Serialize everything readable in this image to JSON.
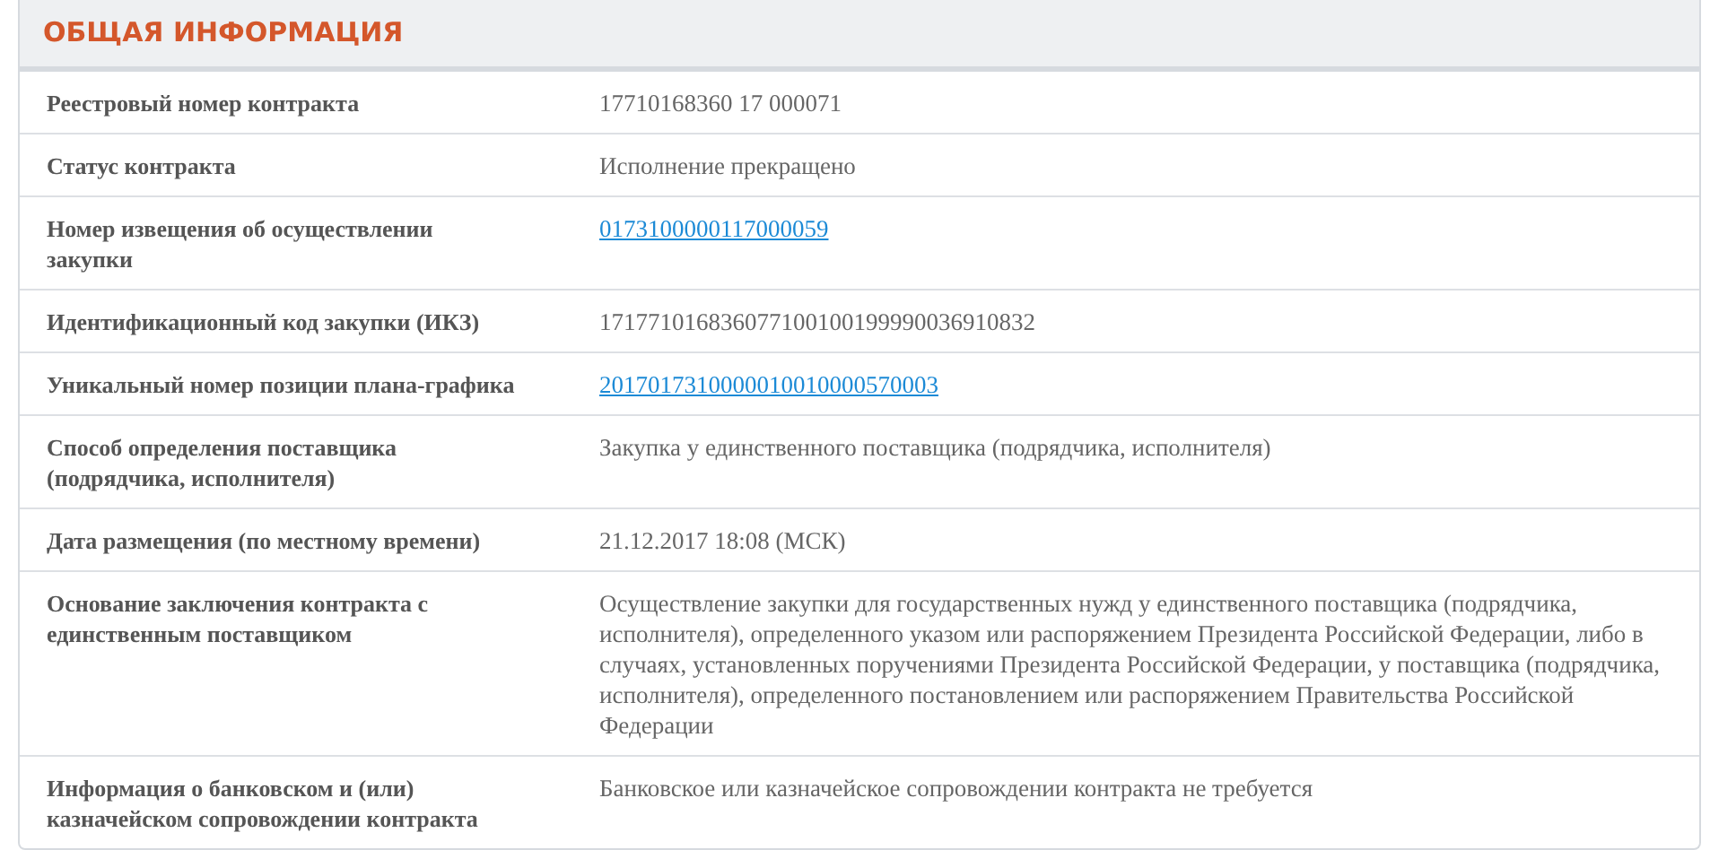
{
  "section": {
    "title": "ОБЩАЯ ИНФОРМАЦИЯ"
  },
  "rows": [
    {
      "label": "Реестровый номер контракта",
      "kind": "text",
      "value": "17710168360 17 000071"
    },
    {
      "label": "Статус контракта",
      "kind": "text",
      "value": "Исполнение прекращено"
    },
    {
      "label": "Номер извещения об осуществлении закупки",
      "kind": "link",
      "value": "0173100000117000059"
    },
    {
      "label": "Идентификационный код закупки (ИКЗ)",
      "kind": "text",
      "value": "171771016836077100100199990036910832"
    },
    {
      "label": "Уникальный номер позиции плана-графика",
      "kind": "link",
      "value": "2017017310000010010000570003"
    },
    {
      "label": "Способ определения поставщика (подрядчика, исполнителя)",
      "kind": "text",
      "value": "Закупка у единственного поставщика (подрядчика, исполнителя)"
    },
    {
      "label": "Дата размещения (по местному времени)",
      "kind": "text",
      "value": "21.12.2017 18:08 (МСК)"
    },
    {
      "label": "Основание заключения контракта с единственным поставщиком",
      "kind": "text",
      "value": "Осуществление закупки для государственных нужд у единственного поставщика (подрядчика, исполнителя), определенного указом или распоряжением Президента Российской Федерации, либо в случаях, установленных поручениями Президента Российской Федерации, у поставщика (подрядчика, исполнителя), определенного постановлением или распоряжением Правительства Российской Федерации"
    },
    {
      "label": "Информация о банковском и (или) казначейском сопровождении контракта",
      "kind": "text",
      "value": "Банковское или казначейское сопровождении контракта не требуется"
    }
  ]
}
